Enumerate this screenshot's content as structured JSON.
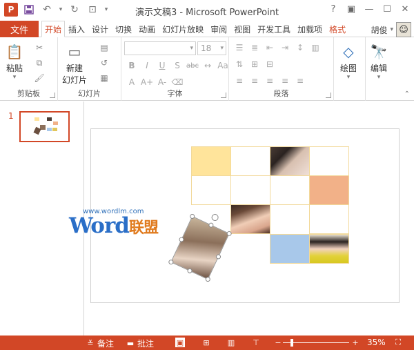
{
  "app": {
    "title": "演示文稿3 - Microsoft PowerPoint",
    "logo_letter": "P",
    "accent_color": "#d24726"
  },
  "qat": {
    "save_icon": "save-icon",
    "undo_icon": "undo-icon",
    "redo_icon": "redo-icon",
    "start_icon": "slideshow-from-start-icon"
  },
  "window_controls": [
    "help-icon",
    "ribbon-display-icon",
    "minimize-icon",
    "maximize-icon",
    "close-icon"
  ],
  "tabs": {
    "file": "文件",
    "items": [
      "开始",
      "插入",
      "设计",
      "切换",
      "动画",
      "幻灯片放映",
      "审阅",
      "视图",
      "开发工具",
      "加载项",
      "格式"
    ],
    "active_index": 0
  },
  "user": {
    "name": "胡俊"
  },
  "ribbon": {
    "clipboard": {
      "paste": "粘贴",
      "label": "剪贴板"
    },
    "slides": {
      "new_slide_line1": "新建",
      "new_slide_line2": "幻灯片",
      "label": "幻灯片"
    },
    "font": {
      "font_name": "",
      "font_size": "18",
      "label": "字体"
    },
    "paragraph": {
      "label": "段落"
    },
    "drawing": {
      "label": "绘图"
    },
    "editing": {
      "label": "编辑"
    }
  },
  "thumbnails": [
    {
      "number": "1"
    }
  ],
  "slide": {
    "grid_colors": {
      "yellow": "#ffe49b",
      "orange": "#f2b188",
      "blue": "#a8c8ea",
      "line": "#f2d99a"
    }
  },
  "watermark": {
    "url": "www.wordlm.com",
    "word": "Word",
    "cn": "联盟"
  },
  "statusbar": {
    "notes": "备注",
    "comments": "批注",
    "zoom": "35%"
  }
}
